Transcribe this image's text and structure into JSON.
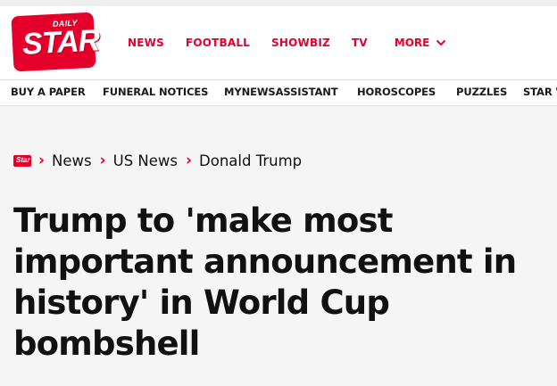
{
  "logo": {
    "top_text": "DAILY",
    "main_text": "STAR"
  },
  "main_nav": {
    "items": [
      "NEWS",
      "FOOTBALL",
      "SHOWBIZ",
      "TV"
    ],
    "more_label": "MORE"
  },
  "sub_nav": {
    "items": [
      "BUY A PAPER",
      "FUNERAL NOTICES",
      "MYNEWSASSISTANT",
      "HOROSCOPES",
      "PUZZLES",
      "STAR V"
    ]
  },
  "breadcrumb": {
    "logo_text": "Star",
    "items": [
      "News",
      "US News",
      "Donald Trump"
    ]
  },
  "article": {
    "headline": "Trump to 'make most important announcement in history' in World Cup bombshell"
  },
  "colors": {
    "brand": "#e4002b",
    "text": "#111111",
    "background": "#f5f5f5"
  },
  "icons": {
    "more": "chevron-down-icon",
    "separator": "chevron-right-icon"
  }
}
